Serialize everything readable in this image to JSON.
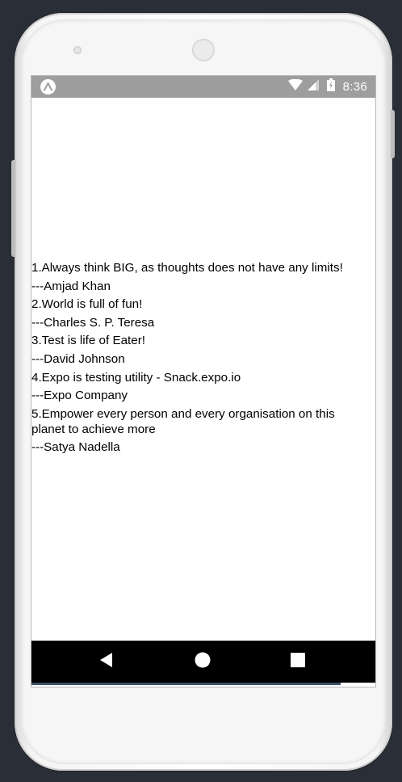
{
  "status_bar": {
    "app_icon": "expo-logo-icon",
    "icons": [
      "wifi-icon",
      "cell-signal-icon",
      "battery-charging-icon"
    ],
    "time": "8:36"
  },
  "quotes": [
    "1.Always think BIG, as thoughts does not have any limits!",
    "---Amjad Khan",
    "2.World is full of fun!",
    "---Charles S. P. Teresa",
    "3.Test is life of Eater!",
    "---David Johnson",
    "4.Expo is testing utility - Snack.expo.io",
    "---Expo Company",
    "5.Empower every person and every organisation on this planet  to achieve more",
    "---Satya Nadella"
  ],
  "nav_bar": {
    "buttons": [
      "back-icon",
      "home-icon",
      "recents-icon"
    ]
  },
  "progress": {
    "value": 0.9
  }
}
